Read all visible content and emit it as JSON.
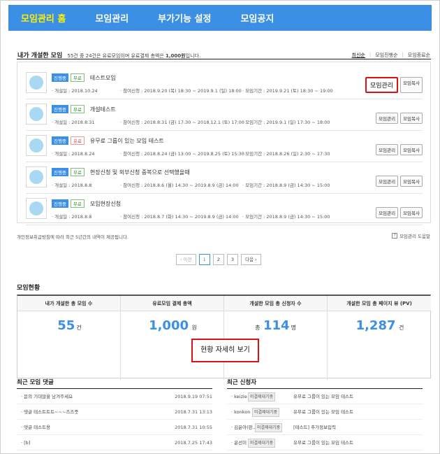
{
  "nav": {
    "tabs": [
      {
        "label": "모임관리 홈",
        "active": true
      },
      {
        "label": "모임관리",
        "active": false
      },
      {
        "label": "부가기능 설정",
        "active": false
      },
      {
        "label": "모임공지",
        "active": false
      }
    ]
  },
  "myEvents": {
    "title": "내가 개설한 모임",
    "summary_pre": "55건 중 24건은 유료모임이며 유료결제 총액은",
    "summary_amount": "1,000원",
    "summary_post": "입니다.",
    "sort": [
      "최신순",
      "모임진행순",
      "모임종료순"
    ],
    "rows": [
      {
        "status": "진행중",
        "type": "무료",
        "type_kind": "free",
        "title": "테스트모임",
        "opened": "· 개설일 : 2018.10.24",
        "apply": "· 참여신청 : 2018.9.20 (목) 18:30 ~ 2019.9.1 (일) 18:00",
        "period": "· 모임기간 : 2019.9.21 (토) 18:30 ~ 19:00",
        "btn_manage": "모임관리",
        "btn_copy": "모임복사",
        "highlight": true
      },
      {
        "status": "진행중",
        "type": "무료",
        "type_kind": "free",
        "title": "개설테스트",
        "opened": "· 개설일 : 2018.8.31",
        "apply": "· 참여신청 : 2018.8.31 (금) 17:30 ~ 2018.12.1 (토) 17:00",
        "period": "· 모임기간 : 2019.9.1 (일) 17:30 ~ 18:00",
        "btn_manage": "모임관리",
        "btn_copy": "모임복사",
        "highlight": false
      },
      {
        "status": "진행중",
        "type": "유료",
        "type_kind": "paid",
        "title": "유무료 그룹이 있는 모임 테스트",
        "opened": "· 개설일 : 2018.8.24",
        "apply": "· 참여신청 : 2018.8.24 (금) 13:00 ~ 2019.8.25 (토) 15:30",
        "period": "· 모임기간 : 2018.8.26 (일) 2:30 ~ 17:30",
        "btn_manage": "모임관리",
        "btn_copy": "모임복사",
        "highlight": false
      },
      {
        "status": "진행중",
        "type": "무료",
        "type_kind": "free",
        "title": "현장신청 및 외부신청 중복으로 선택했을때",
        "opened": "· 개설일 : 2018.8.8",
        "apply": "· 참여신청 : 2018.8.6 (월) 14:30 ~ 2019.8.9 (금) 14:00",
        "period": "· 모임기간 : 2018.8.9 (금) 14:30 ~ 15:00",
        "btn_manage": "모임관리",
        "btn_copy": "모임복사",
        "highlight": false
      },
      {
        "status": "진행중",
        "type": "무료",
        "type_kind": "free",
        "title": "모임현장신청",
        "opened": "· 개설일 : 2018.8.8",
        "apply": "· 참여신청 : 2018.8.7 (화) 14:30 ~ 2019.8.9 (금) 14:00",
        "period": "· 모임기간 : 2018.8.9 (금) 14:30 ~ 15:00",
        "btn_manage": "모임관리",
        "btn_copy": "모임복사",
        "highlight": false
      }
    ],
    "note": "개인정보취급방침에 따라 최근 5년간의 내역이 제공됩니다.",
    "help_label": "모임관리 도움말"
  },
  "pager": {
    "prev": "‹ 이전",
    "pages": [
      "1",
      "2",
      "3"
    ],
    "current": "1",
    "next": "다음 ›"
  },
  "stats": {
    "title": "모임현황",
    "cols": [
      {
        "head": "내가 개설한 총 모임 수",
        "prefix": "",
        "value": "55",
        "unit": "건"
      },
      {
        "head": "유료모임 결제 총액",
        "prefix": "",
        "value": "1,000",
        "unit": "원"
      },
      {
        "head": "개설한 모임 총 신청자 수",
        "prefix": "총",
        "value": "114",
        "unit": "명"
      },
      {
        "head": "개설한 모임 총 페이지 뷰 (PV)",
        "prefix": "",
        "value": "1,287",
        "unit": "건"
      }
    ],
    "detail_btn": "현황 자세히 보기"
  },
  "comments": {
    "title": "최근 모임 댓글",
    "items": [
      {
        "text": "· 문의 기대많을 남겨주세요",
        "date": "2018.9.19 07:51"
      },
      {
        "text": "· 댓글 테스트트트~~~즈즈줏",
        "date": "2018.7.31 13:13"
      },
      {
        "text": "· 댓글 테스트용",
        "date": "2018.7.31 10:55"
      },
      {
        "text": "· [b]",
        "date": "2018.7.25 17:43"
      }
    ]
  },
  "applicants": {
    "title": "최근 신청자",
    "items": [
      {
        "name": "· keizie",
        "tag": "미결제대기중",
        "event": "유무료 그룹이 있는 모임 테스트"
      },
      {
        "name": "· konkon",
        "tag": "미결제대기중",
        "event": "유무료 그룹이 있는 모임 테스트"
      },
      {
        "name": "· 김윤아(판...",
        "tag": "미결제대기중",
        "event": "[테스트] 추가정보입력"
      },
      {
        "name": "· 윤선미",
        "tag": "미결제대기중",
        "event": "유무료 그룹이 있는 모임 테스트"
      }
    ]
  }
}
